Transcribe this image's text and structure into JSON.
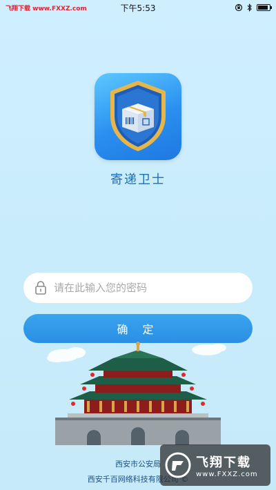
{
  "status_bar": {
    "watermark_brand": "飞翔下载",
    "watermark_url": "www.FXXZ.com",
    "time": "下午5:53",
    "battery_level": 0.85
  },
  "app": {
    "name": "寄递卫士",
    "icon": "shield-package-icon"
  },
  "login": {
    "password_placeholder": "请在此输入您的密码",
    "password_value": "",
    "confirm_label": "确 定"
  },
  "footer": {
    "line1": "西安市公安局",
    "line2": "西安千百网络科技有限公司 ©"
  },
  "watermark": {
    "title": "飞翔下载",
    "url": "www.FXXZ.com"
  },
  "colors": {
    "background": "#cfefff",
    "accent": "#2b8fe3",
    "app_name": "#1e6fbd"
  }
}
